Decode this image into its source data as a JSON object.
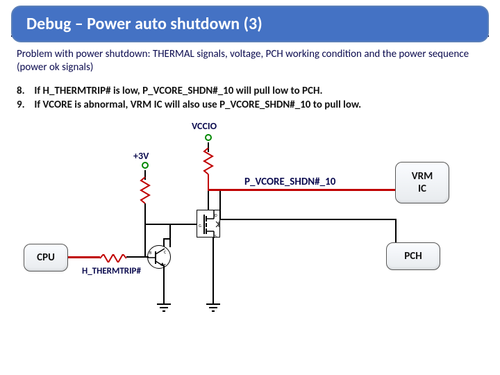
{
  "title": "Debug – Power auto shutdown (3)",
  "problem": "Problem with power shutdown: THERMAL signals, voltage, PCH working condition and the power sequence (power ok signals)",
  "steps": [
    {
      "num": "8.",
      "text": "If H_THERMTRIP# is low, P_VCORE_SHDN#_10 will  pull low to PCH."
    },
    {
      "num": "9.",
      "text": "If VCORE is abnormal, VRM IC will also use P_VCORE_SHDN#_10  to pull low."
    }
  ],
  "labels": {
    "vccio": "VCCIO",
    "p3v": "+3V",
    "signal": "P_VCORE_SHDN#_10",
    "thermtrip": "H_THERMTRIP#"
  },
  "blocks": {
    "cpu": "CPU",
    "vrm": "VRM\nIC",
    "pch": "PCH"
  },
  "chart_data": {
    "type": "diagram",
    "description": "Schematic: VCCIO and +3V rails each through pull-up resistor to P_VCORE_SHDN#_10 node. Node goes to VRM IC and PCH blocks. A MOSFET can pull node low; its gate is driven by a BJT stage fed by H_THERMTRIP# from the CPU block via a series resistor. BJT emitter and MOSFET source go to ground.",
    "rails": [
      "VCCIO",
      "+3V"
    ],
    "signals": [
      "P_VCORE_SHDN#_10",
      "H_THERMTRIP#"
    ],
    "blocks": [
      "CPU",
      "VRM IC",
      "PCH"
    ],
    "components": [
      "pull-up resistor (VCCIO)",
      "pull-up resistor (+3V)",
      "series resistor (H_THERMTRIP#)",
      "N-MOSFET open-drain",
      "NPN BJT driver",
      "ground x2"
    ]
  }
}
